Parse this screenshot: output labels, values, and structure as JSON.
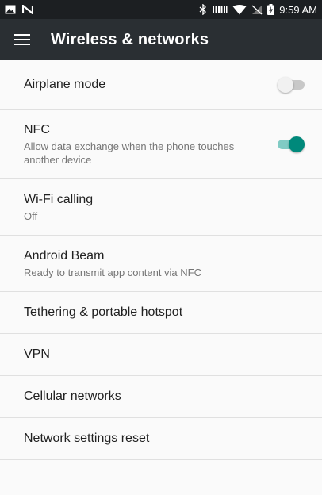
{
  "status_bar": {
    "time": "9:59 AM",
    "icons_left": [
      "image-icon",
      "n-notification-icon"
    ],
    "icons_right": [
      "bluetooth-icon",
      "vibrate-icon",
      "wifi-icon",
      "no-signal-icon",
      "battery-charging-icon"
    ]
  },
  "app_bar": {
    "title": "Wireless & networks",
    "menu_icon": "hamburger-menu-icon"
  },
  "settings": {
    "airplane": {
      "title": "Airplane mode",
      "toggle": false
    },
    "nfc": {
      "title": "NFC",
      "summary": "Allow data exchange when the phone touches another device",
      "toggle": true
    },
    "wifi_calling": {
      "title": "Wi-Fi calling",
      "summary": "Off"
    },
    "android_beam": {
      "title": "Android Beam",
      "summary": "Ready to transmit app content via NFC"
    },
    "tethering": {
      "title": "Tethering & portable hotspot"
    },
    "vpn": {
      "title": "VPN"
    },
    "cellular": {
      "title": "Cellular networks"
    },
    "reset": {
      "title": "Network settings reset"
    }
  },
  "colors": {
    "accent": "#00897b",
    "status_bar": "#1c1f22",
    "app_bar": "#2a2f33"
  }
}
